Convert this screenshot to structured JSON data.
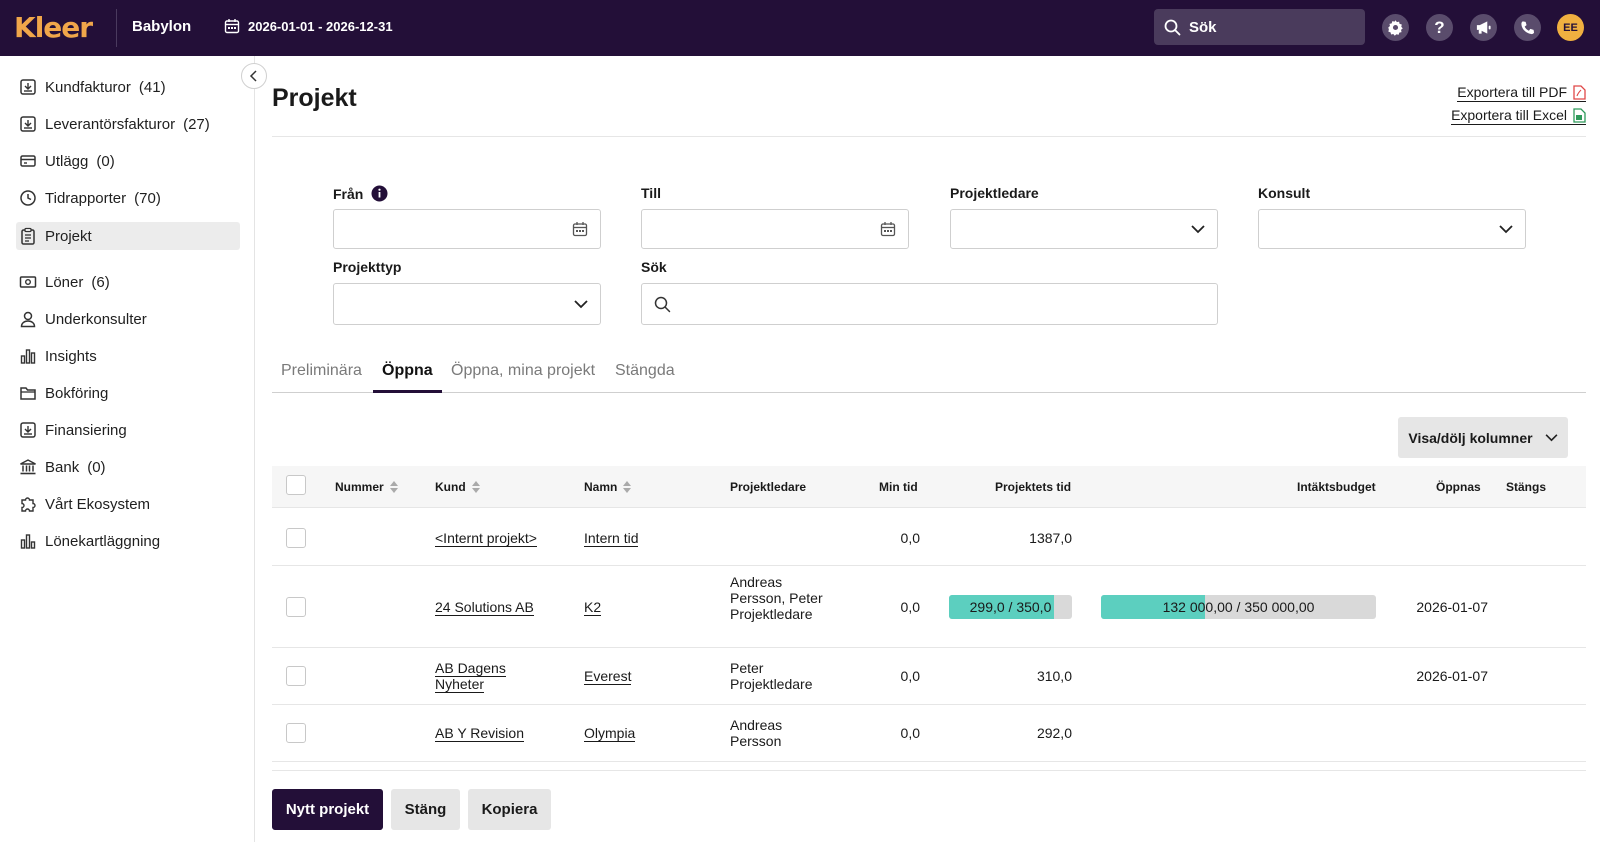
{
  "topbar": {
    "logo": "Kleer",
    "company": "Babylon",
    "period": "2026-01-01 - 2026-12-31",
    "search_placeholder": "Sök",
    "avatar": "EE"
  },
  "sidebar": {
    "items": [
      {
        "label": "Kundfakturor",
        "count": "(41)"
      },
      {
        "label": "Leverantörsfakturor",
        "count": "(27)"
      },
      {
        "label": "Utlägg",
        "count": "(0)"
      },
      {
        "label": "Tidrapporter",
        "count": "(70)"
      },
      {
        "label": "Projekt",
        "count": ""
      },
      {
        "label": "Löner",
        "count": "(6)"
      },
      {
        "label": "Underkonsulter",
        "count": ""
      },
      {
        "label": "Insights",
        "count": ""
      },
      {
        "label": "Bokföring",
        "count": ""
      },
      {
        "label": "Finansiering",
        "count": ""
      },
      {
        "label": "Bank",
        "count": "(0)"
      },
      {
        "label": "Vårt Ekosystem",
        "count": ""
      },
      {
        "label": "Lönekartläggning",
        "count": ""
      }
    ]
  },
  "page": {
    "title": "Projekt",
    "export_pdf": "Exportera till PDF",
    "export_excel": "Exportera till Excel"
  },
  "filters": {
    "from_label": "Från",
    "to_label": "Till",
    "manager_label": "Projektledare",
    "consultant_label": "Konsult",
    "type_label": "Projekttyp",
    "search_label": "Sök",
    "from_value": "",
    "to_value": "",
    "search_value": ""
  },
  "tabs": [
    {
      "label": "Preliminära"
    },
    {
      "label": "Öppna"
    },
    {
      "label": "Öppna, mina projekt"
    },
    {
      "label": "Stängda"
    }
  ],
  "columns_button": "Visa/dölj kolumner",
  "table": {
    "headers": {
      "number": "Nummer",
      "customer": "Kund",
      "name": "Namn",
      "manager": "Projektledare",
      "my_time": "Min tid",
      "project_time": "Projektets tid",
      "revenue_budget": "Intäktsbudget",
      "opens": "Öppnas",
      "closes": "Stängs"
    },
    "rows": [
      {
        "number": "",
        "customer": "<Internt projekt>",
        "name": "Intern tid",
        "manager": "",
        "my_time": "0,0",
        "project_time": "1387,0",
        "revenue_budget": "",
        "opens": "",
        "closes": ""
      },
      {
        "number": "",
        "customer": "24 Solutions AB",
        "name": "K2",
        "manager": "Andreas Persson, Peter Projektledare",
        "my_time": "0,0",
        "project_time": "299,0 / 350,0",
        "project_time_fraction": 0.854,
        "revenue_budget": "132 000,00 / 350 000,00",
        "revenue_budget_fraction": 0.377,
        "opens": "2026-01-07",
        "closes": ""
      },
      {
        "number": "",
        "customer": "AB Dagens Nyheter",
        "name": "Everest",
        "manager": "Peter Projektledare",
        "my_time": "0,0",
        "project_time": "310,0",
        "revenue_budget": "",
        "opens": "2026-01-07",
        "closes": ""
      },
      {
        "number": "",
        "customer": "AB Y Revision",
        "name": "Olympia",
        "manager": "Andreas Persson",
        "my_time": "0,0",
        "project_time": "292,0",
        "revenue_budget": "",
        "opens": "",
        "closes": ""
      }
    ]
  },
  "actions": {
    "new_project": "Nytt projekt",
    "close": "Stäng",
    "copy": "Kopiera"
  },
  "colors": {
    "topbar": "#230f38",
    "accent_logo": "#f0a64a",
    "progress_fill": "#5ccfbf",
    "progress_track": "#d9d9d9"
  }
}
